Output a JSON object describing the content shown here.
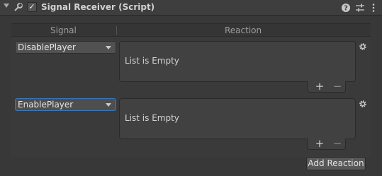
{
  "component": {
    "title": "Signal Receiver (Script)",
    "enabled_check": "✓",
    "icons": [
      "foldout-arrow-icon",
      "script-icon",
      "help-icon",
      "preset-icon",
      "kebab-menu-icon"
    ]
  },
  "table": {
    "col_signal": "Signal",
    "col_reaction": "Reaction"
  },
  "rows": [
    {
      "signal": "DisablePlayer",
      "reaction_text": "List is Empty",
      "add": "+",
      "remove": "−"
    },
    {
      "signal": "EnablePlayer",
      "reaction_text": "List is Empty",
      "add": "+",
      "remove": "−"
    }
  ],
  "add_reaction_label": "Add Reaction",
  "colors": {
    "background": "#383838",
    "selected_border": "#3a79bb"
  }
}
